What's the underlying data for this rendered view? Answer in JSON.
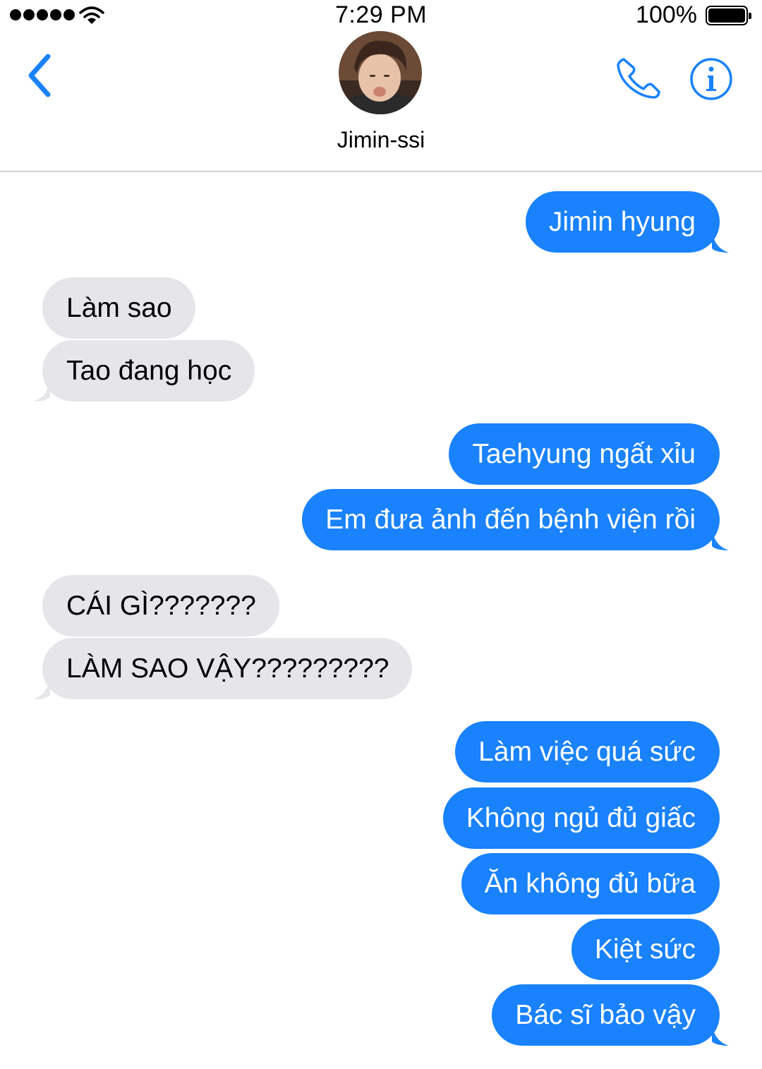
{
  "status_bar": {
    "time": "7:29 PM",
    "battery_percent": "100%",
    "signal_icon": "signal-dots-icon",
    "wifi_icon": "wifi-icon",
    "battery_icon": "battery-icon"
  },
  "header": {
    "contact_name": "Jimin-ssi",
    "back_icon": "chevron-left-icon",
    "call_icon": "phone-icon",
    "info_icon": "info-icon",
    "accent_color": "#1982fc"
  },
  "colors": {
    "outgoing_bubble": "#1982fc",
    "incoming_bubble": "#e5e5ea"
  },
  "messages": [
    {
      "direction": "out",
      "text": "Jimin hyung",
      "tail": true
    },
    {
      "direction": "in",
      "text": "Làm sao",
      "tail": false
    },
    {
      "direction": "in",
      "text": "Tao đang học",
      "tail": true
    },
    {
      "direction": "out",
      "text": "Taehyung ngất xỉu",
      "tail": false
    },
    {
      "direction": "out",
      "text": "Em đưa ảnh đến bệnh viện rồi",
      "tail": true
    },
    {
      "direction": "in",
      "text": "CÁI GÌ???????",
      "tail": false
    },
    {
      "direction": "in",
      "text": "LÀM SAO VẬY?????????",
      "tail": true
    },
    {
      "direction": "out",
      "text": "Làm việc quá sức",
      "tail": false
    },
    {
      "direction": "out",
      "text": "Không ngủ đủ giấc",
      "tail": false
    },
    {
      "direction": "out",
      "text": "Ăn không đủ bữa",
      "tail": false
    },
    {
      "direction": "out",
      "text": "Kiệt sức",
      "tail": false
    },
    {
      "direction": "out",
      "text": "Bác sĩ bảo vậy",
      "tail": true
    }
  ]
}
